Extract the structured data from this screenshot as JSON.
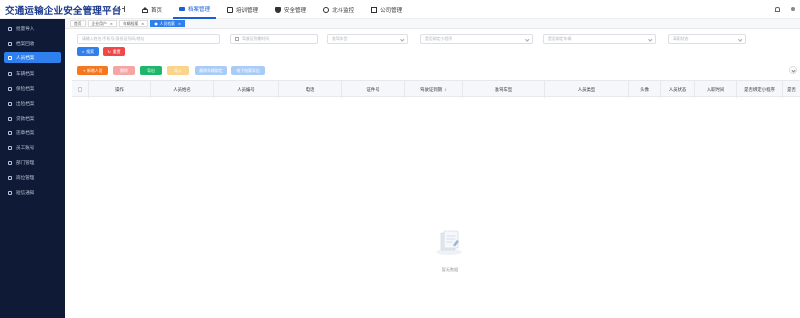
{
  "app": {
    "title": "交通运输企业安全管理平台"
  },
  "topnav": [
    {
      "label": "首页",
      "icon": "home-icon",
      "active": false
    },
    {
      "label": "档案管理",
      "icon": "truck-icon",
      "active": true
    },
    {
      "label": "培训管理",
      "icon": "book-icon",
      "active": false
    },
    {
      "label": "安全管理",
      "icon": "shield-icon",
      "active": false
    },
    {
      "label": "北斗监控",
      "icon": "gear-icon",
      "active": false
    },
    {
      "label": "公司管理",
      "icon": "building-icon",
      "active": false
    }
  ],
  "sidebar": {
    "items": [
      {
        "label": "批量导入",
        "active": false
      },
      {
        "label": "档案回收",
        "active": false
      },
      {
        "label": "人员档案",
        "active": true
      },
      {
        "label": "车辆档案",
        "active": false
      },
      {
        "label": "保险档案",
        "active": false
      },
      {
        "label": "出险档案",
        "active": false
      },
      {
        "label": "贷款档案",
        "active": false
      },
      {
        "label": "违章档案",
        "active": false
      },
      {
        "label": "员工账号",
        "active": false
      },
      {
        "label": "部门管理",
        "active": false
      },
      {
        "label": "岗位管理",
        "active": false
      },
      {
        "label": "短信通知",
        "active": false
      }
    ]
  },
  "tags": [
    {
      "label": "首页",
      "active": false,
      "closable": false
    },
    {
      "label": "企业用户",
      "active": false,
      "closable": true
    },
    {
      "label": "车辆档案",
      "active": false,
      "closable": true
    },
    {
      "label": "人员档案",
      "active": true,
      "closable": true
    }
  ],
  "filters": {
    "keyword_placeholder": "请输入姓名/手机号/身份证号码/地址",
    "license_expiry_placeholder": "驾驶证到期时间",
    "vehicle_class_placeholder": "准驾车型",
    "mini_program_binding_placeholder": "是否绑定小程序",
    "driver_bound_placeholder": "是否绑定车辆",
    "status_placeholder": "离职状态"
  },
  "buttons": {
    "search": "搜索",
    "reset": "重置",
    "add_person": "+ 新增人员",
    "delete": "删除",
    "export": "导出",
    "import": "导入",
    "terminate_contract": "解除车辆绑定",
    "download_template": "电子档案导出"
  },
  "colors": {
    "brand": "#1b3a8c",
    "primary": "#2f80ed",
    "danger": "#f04848",
    "success": "#1fb56a",
    "warning": "#f59b23"
  },
  "table": {
    "columns": [
      "操作",
      "人员姓名",
      "人员编号",
      "电话",
      "证件号",
      "驾驶证到期",
      "准驾车型",
      "人员类型",
      "头像",
      "人员状态",
      "入职时间",
      "是否绑定小程序",
      "是否"
    ],
    "rows": [],
    "empty_text": "暂无数据"
  }
}
